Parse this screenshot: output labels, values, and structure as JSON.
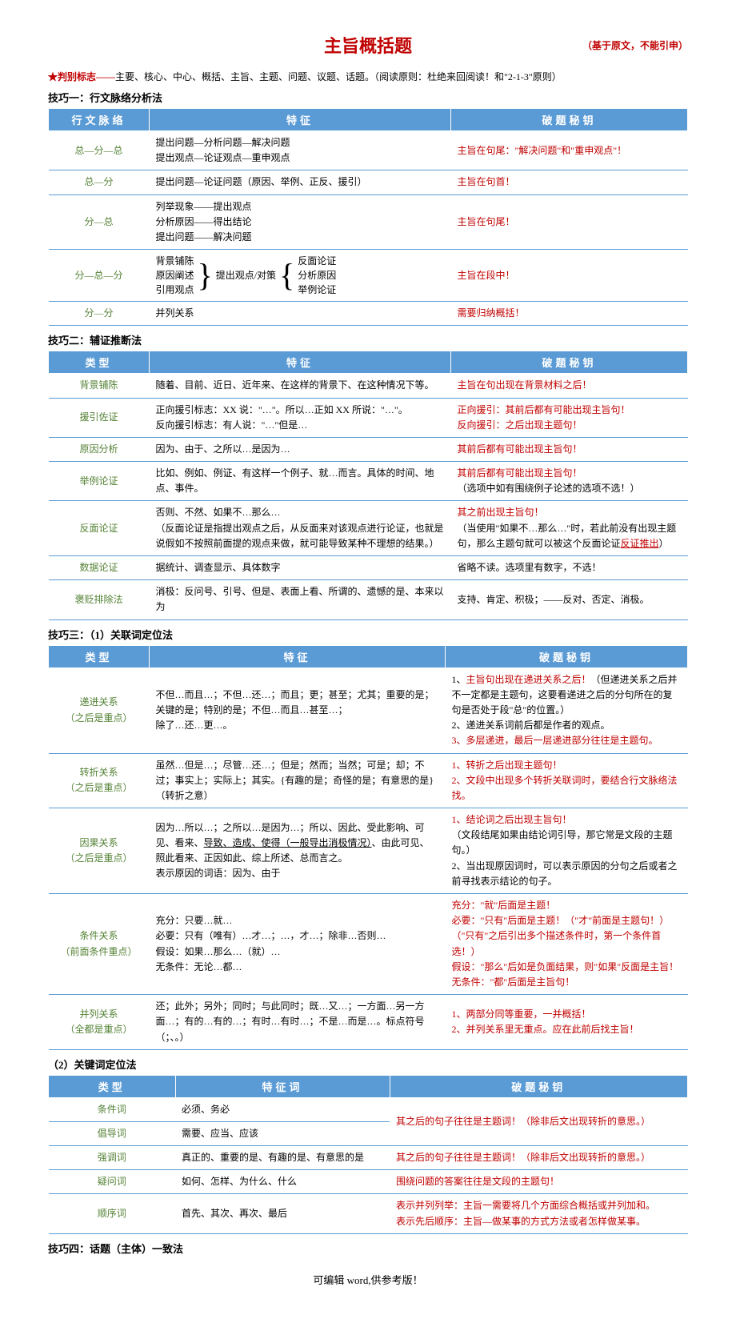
{
  "title": "主旨概括题",
  "title_note": "（基于原文，不能引申）",
  "marker_prefix": "★判别标志——",
  "marker_body": "主要、核心、中心、概括、主旨、主题、问题、议题、话题。（阅读原则：杜绝来回阅读！和\"2-1-3\"原则）",
  "s1_title": "技巧一：行文脉络分析法",
  "s2_title": "技巧二：辅证推断法",
  "s3_title": "技巧三：（1）关联词定位法",
  "s3b_title": "（2）关键词定位法",
  "s4_title": "技巧四：话题（主体）一致法",
  "footer": "可编辑 word,供参考版！",
  "h_type": "类型",
  "h_flow": "行文脉络",
  "h_feat": "特征",
  "h_featword": "特征词",
  "h_key": "破题秘钥",
  "t1": {
    "r1_type": "总—分—总",
    "r1_feat": "提出问题—分析问题—解决问题\n提出观点—论证观点—重申观点",
    "r1_key": "主旨在句尾：\"解决问题\"和\"重申观点\"！",
    "r2_type": "总—分",
    "r2_feat": "提出问题—论证问题（原因、举例、正反、援引）",
    "r2_key": "主旨在句首！",
    "r3_type": "分—总",
    "r3_feat": "列举现象——提出观点\n分析原因——得出结论\n提出问题——解决问题",
    "r3_key": "主旨在句尾！",
    "r4_type": "分—总—分",
    "r4_l1": "背景铺陈",
    "r4_l2": "原因阐述",
    "r4_l3": "引用观点",
    "r4_mid": "提出观点/对策",
    "r4_r1": "反面论证",
    "r4_r2": "分析原因",
    "r4_r3": "举例论证",
    "r4_key": "主旨在段中！",
    "r5_type": "分—分",
    "r5_feat": "并列关系",
    "r5_key": "需要归纳概括！"
  },
  "t2": {
    "r1_type": "背景铺陈",
    "r1_feat": "随着、目前、近日、近年来、在这样的背景下、在这种情况下等。",
    "r1_key": "主旨在句出现在背景材料之后！",
    "r2_type": "援引佐证",
    "r2_feat": "正向援引标志：XX 说：\"…\"。所以…正如 XX 所说：\"…\"。\n反向援引标志：有人说：\"…\"但是…",
    "r2_keyA": "正向援引：其前后都有可能出现主旨句！",
    "r2_keyB": "反向援引：之后出现主题句！",
    "r3_type": "原因分析",
    "r3_feat": "因为、由于、之所以…是因为…",
    "r3_key": "其前后都有可能出现主旨句！",
    "r4_type": "举例论证",
    "r4_feat": "比如、例如、例证、有这样一个例子、就…而言。具体的时间、地点、事件。",
    "r4_keyA": "其前后都有可能出现主旨句！",
    "r4_keyB": "（选项中如有围绕例子论述的选项不选！）",
    "r5_type": "反面论证",
    "r5_feat": "否则、不然、如果不…那么…\n（反面论证是指提出观点之后，从反面来对该观点进行论证，也就是说假如不按照前面提的观点来做，就可能导致某种不理想的结果。）",
    "r5_keyA": "其之前出现主旨句！",
    "r5_keyB": "（当使用\"如果不…那么…\"时，若此前没有出现主题句，那么主题句就可以被这个反面论证",
    "r5_keyC": "反证推出",
    "r5_keyD": "）",
    "r6_type": "数据论证",
    "r6_feat": "据统计、调查显示、具体数字",
    "r6_key": "省略不读。选项里有数字，不选！",
    "r7_type": "褒贬排除法",
    "r7_feat": "消极：反问号、引号、但是、表面上看、所谓的、遗憾的是、本来以为",
    "r7_key": "支持、肯定、积极；——反对、否定、消极。"
  },
  "t3": {
    "r1_type": "递进关系\n（之后是重点）",
    "r1_feat": "不但…而且…；不但…还…；而且；更；甚至；尤其；重要的是；关键的是；特别的是；不但…而且…甚至…；\n除了…还…更…。",
    "r1_k1": "1、",
    "r1_k1t": "主旨句出现在递进关系之后！",
    "r1_k1b": "（但递进关系之后并不一定都是主题句，这要看递进之后的分句所在的复句是否处于段\"总\"的位置。）",
    "r1_k2": "2、递进关系词前后都是作者的观点。",
    "r1_k3": "3、多层递进，最后一层递进部分往往是主题句。",
    "r2_type": "转折关系\n（之后是重点）",
    "r2_feat": "虽然…但是…；尽管…还…；但是；然而；当然；可是；却；不过；事实上；实际上；其实。{有趣的是；奇怪的是；有意思的是}（转折之意）",
    "r2_k1": "1、转折之后出现主题句！",
    "r2_k2": "2、文段中出现多个转折关联词时，要结合行文脉络法找。",
    "r3_type": "因果关系\n（之后是重点）",
    "r3_feat_a": "因为…所以…；之所以…是因为…；所以、因此、受此影响、可见、看来、",
    "r3_feat_b": "导致、造成、使得（一般导出消极情况）",
    "r3_feat_c": "、由此可见、照此看来、正因如此、综上所述、总而言之。\n表示原因的词语：因为、由于",
    "r3_k1": "1、结论词之后出现主旨句！",
    "r3_k1b": "（文段结尾如果由结论词引导，那它常是文段的主题句。）",
    "r3_k2": "2、当出现原因词时，可以表示原因的分句之后或者之前寻找表示结论的句子。",
    "r4_type": "条件关系\n（前面条件重点）",
    "r4_feat": "充分：只要…就…\n必要：只有（唯有）…才…；…，才…；除非…否则…\n假设：如果…那么…（就）…\n无条件：无论…都…",
    "r4_k1": "充分：\"就\"后面是主题！",
    "r4_k2": "必要：\"只有\"后面是主题！（\"才\"前面是主题句！）（\"只有\"之后引出多个描述条件时，第一个条件首选！）",
    "r4_k3": "假设：\"那么\"后如是负面结果，则\"如果\"反面是主旨！",
    "r4_k4": "无条件：\"都\"后面是主旨句！",
    "r5_type": "并列关系\n（全都是重点）",
    "r5_feat": "还；此外；另外；同时；与此同时；既…又…；一方面…另一方面…；有的…有的…；有时…有时…；不是…而是…。标点符号（；、。）",
    "r5_k1": "1、两部分同等重要，一并概括！",
    "r5_k2": "2、并列关系里无重点。应在此前后找主旨！"
  },
  "t4": {
    "r1_type": "条件词",
    "r1_feat": "必须、务必",
    "r12_key": "其之后的句子往往是主题词！（除非后文出现转折的意思。）",
    "r2_type": "倡导词",
    "r2_feat": "需要、应当、应该",
    "r3_type": "强调词",
    "r3_feat": "真正的、重要的是、有趣的是、有意思的是",
    "r3_key": "其之后的句子往往是主题词！（除非后文出现转折的意思。）",
    "r4_type": "疑问词",
    "r4_feat": "如何、怎样、为什么、什么",
    "r4_key": "围绕问题的答案往往是文段的主题句！",
    "r5_type": "顺序词",
    "r5_feat": "首先、其次、再次、最后",
    "r5_k1": "表示并列列举：主旨一需要将几个方面综合概括或并列加和。",
    "r5_k2": "表示先后顺序：主旨—做某事的方式方法或者怎样做某事。"
  }
}
